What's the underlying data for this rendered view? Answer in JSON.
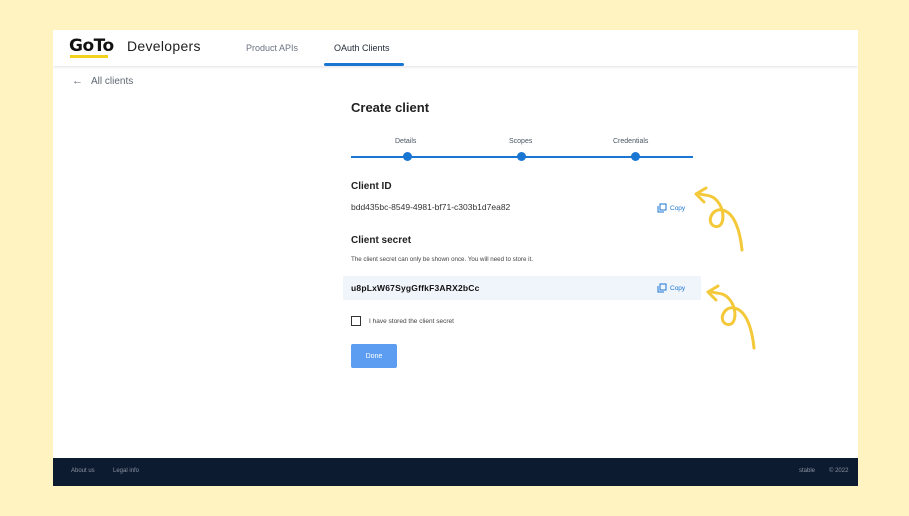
{
  "header": {
    "logo_text": "GoTo",
    "brand": "Developers",
    "nav": [
      "Product APIs",
      "OAuth Clients"
    ],
    "active_tab": "OAuth Clients"
  },
  "back_link": "All clients",
  "page_title": "Create client",
  "stepper": {
    "steps": [
      "Details",
      "Scopes",
      "Credentials"
    ],
    "color": "#1976d2"
  },
  "client_id": {
    "title": "Client ID",
    "value": "bdd435bc-8549-4981-bf71-c303b1d7ea82",
    "copy_label": "Copy"
  },
  "client_secret": {
    "title": "Client secret",
    "note": "The client secret can only be shown once. You will need to store it.",
    "value": "u8pLxW67SygGffkF3ARX2bCc",
    "copy_label": "Copy"
  },
  "stored_checkbox": {
    "label": "I have stored the client secret",
    "checked": false
  },
  "done_button": "Done",
  "footer": {
    "links": [
      "About us",
      "Legal info"
    ],
    "right": "stable",
    "copyright": "© 2022"
  },
  "colors": {
    "background": "#fff3c2",
    "accent": "#1976d2",
    "footer": "#0d1b30",
    "annotation": "#f3c93a"
  }
}
